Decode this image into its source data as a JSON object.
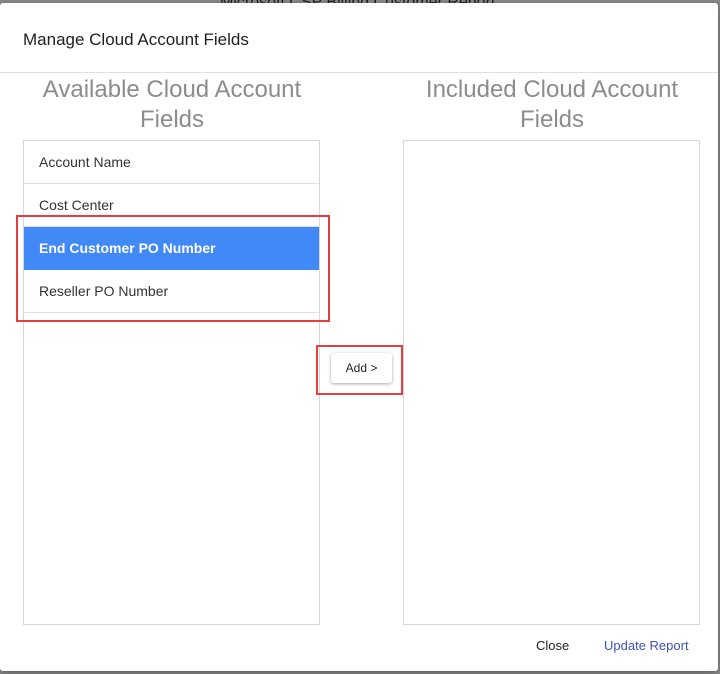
{
  "backdrop": {
    "title": "Microsoft CSP Billing Customer Report"
  },
  "dialog": {
    "title": "Manage Cloud Account Fields",
    "available": {
      "heading": "Available Cloud Account Fields",
      "items": [
        {
          "label": "Account Name",
          "selected": false
        },
        {
          "label": "Cost Center",
          "selected": false
        },
        {
          "label": "End Customer PO Number",
          "selected": true
        },
        {
          "label": "Reseller PO Number",
          "selected": false
        }
      ]
    },
    "included": {
      "heading": "Included Cloud Account Fields",
      "items": []
    },
    "add_label": "Add >",
    "close_label": "Close",
    "update_label": "Update Report"
  },
  "colors": {
    "selected": "#4089f7",
    "highlight": "#e53e3e",
    "update_link": "#3f51b5"
  }
}
